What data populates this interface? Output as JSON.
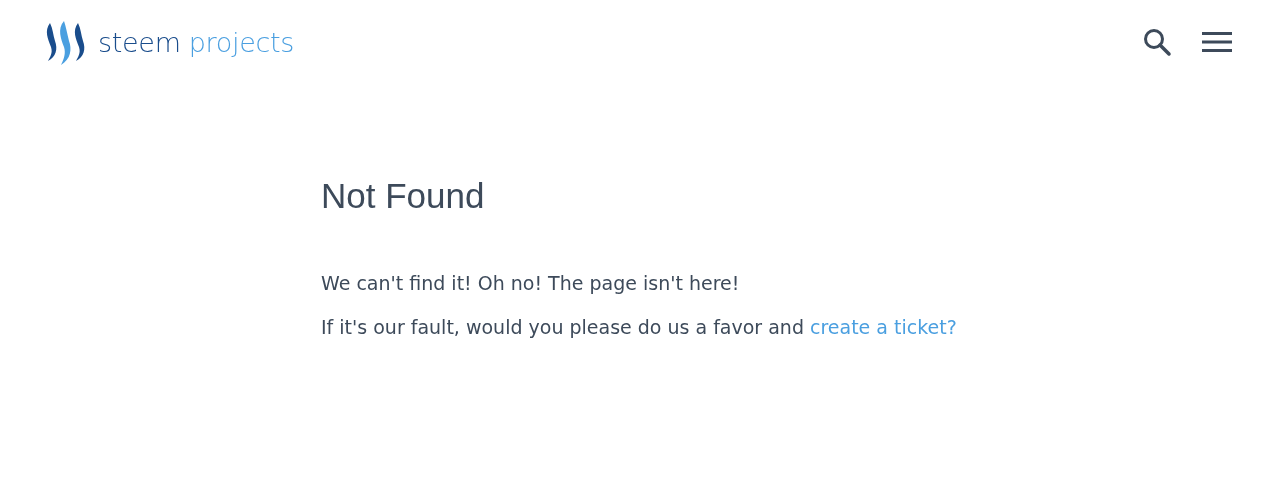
{
  "header": {
    "logo_words": [
      "steem",
      "projects"
    ]
  },
  "content": {
    "title": "Not Found",
    "message": "We can't find it! Oh no! The page isn't here!",
    "prompt": "If it's our fault, would you please do us a favor and",
    "link": "create a ticket?"
  }
}
